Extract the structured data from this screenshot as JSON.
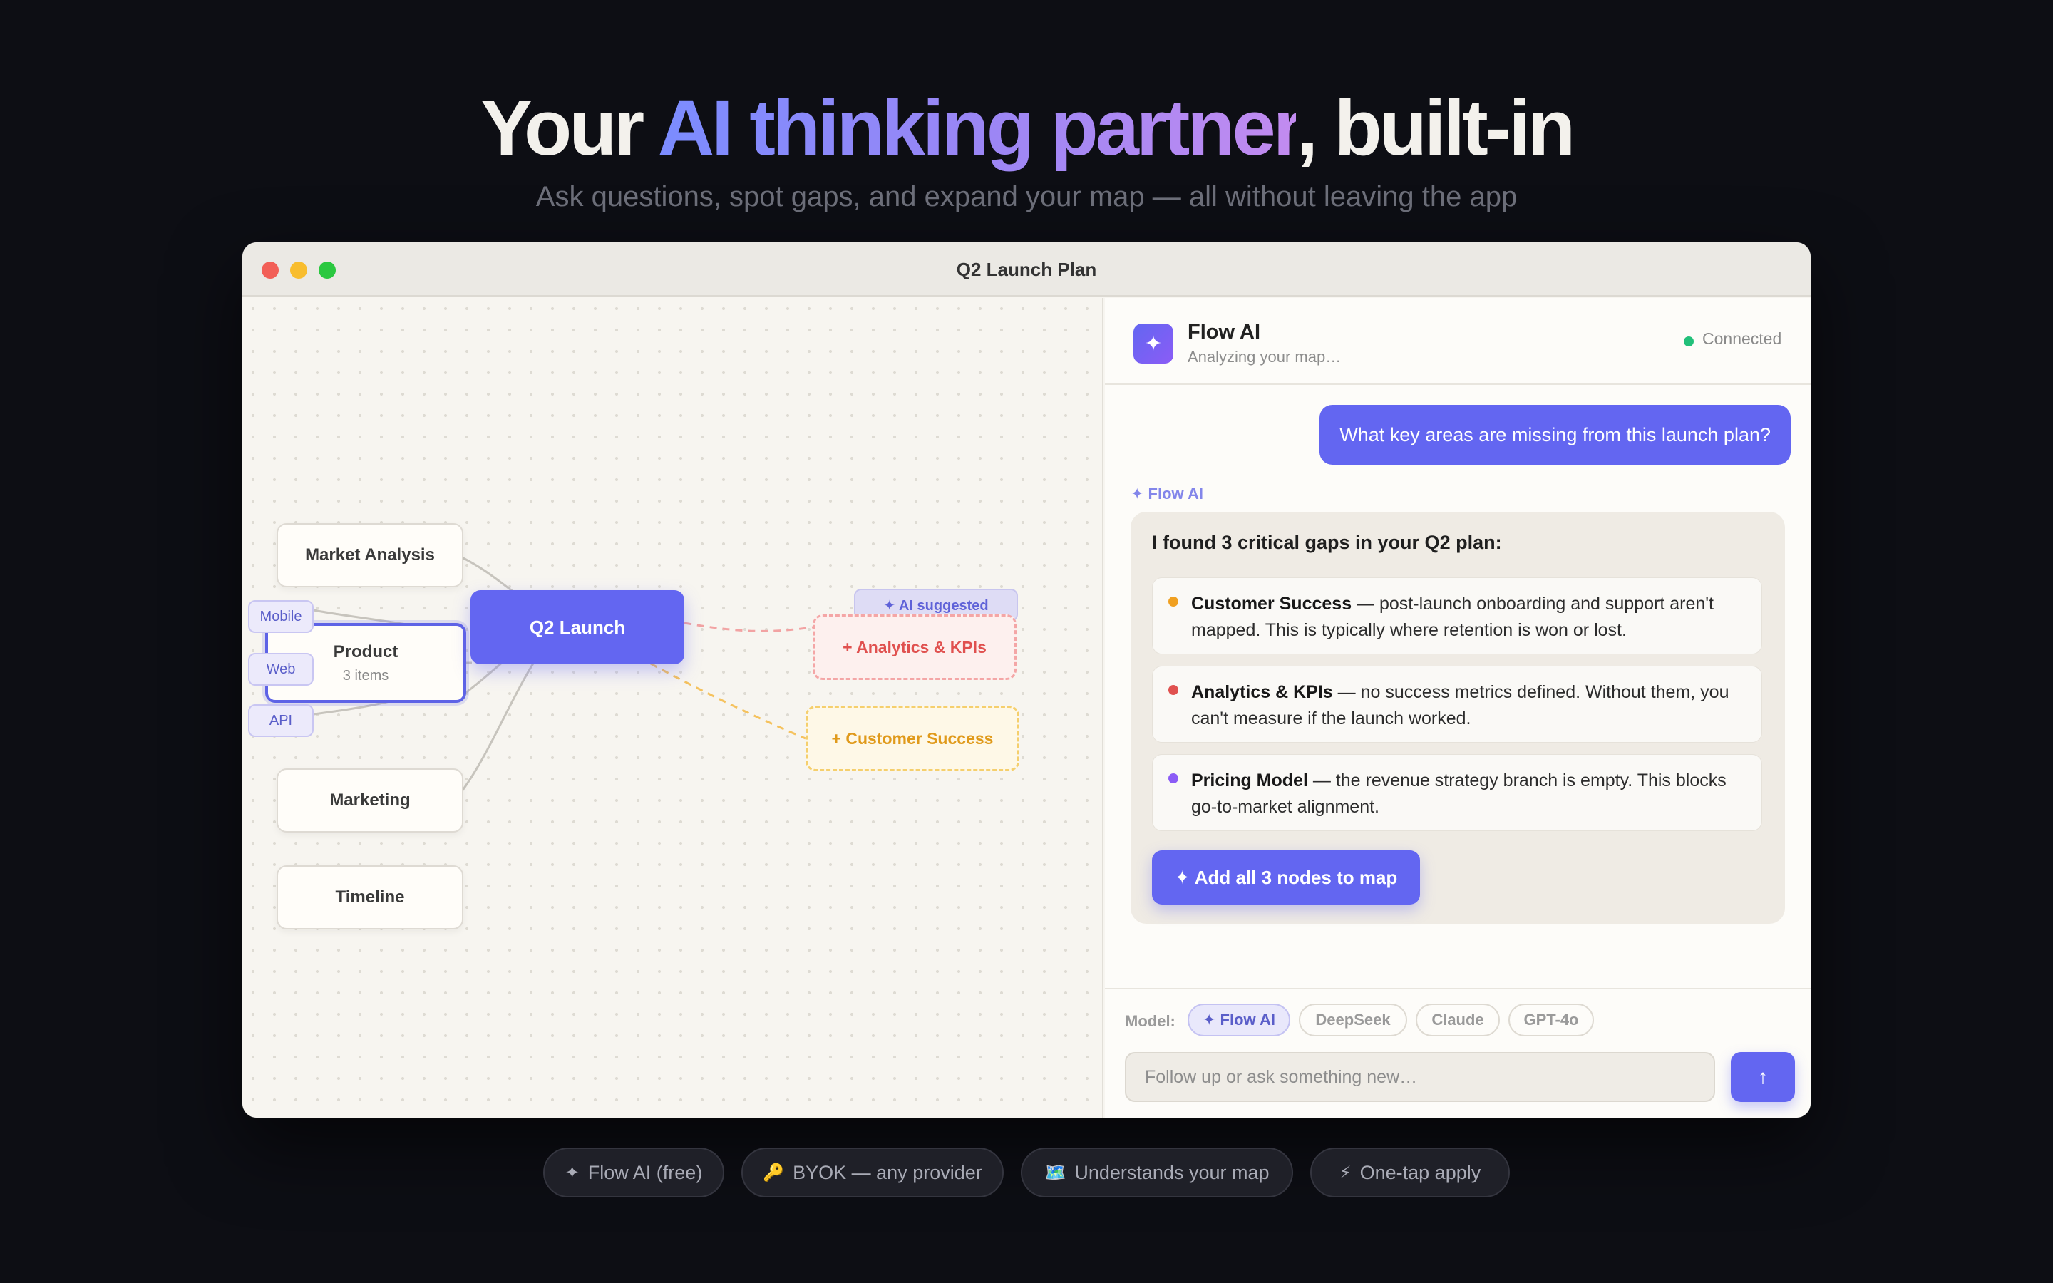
{
  "hero": {
    "title_pre": "Your ",
    "title_highlight": "AI thinking partner",
    "title_post": ", built-in",
    "subtitle": "Ask questions, spot gaps, and expand your map — all without leaving the app"
  },
  "window": {
    "title": "Q2 Launch Plan"
  },
  "canvas": {
    "center": "Q2 Launch",
    "nodes": {
      "market_analysis": "Market Analysis",
      "product": "Product",
      "product_sub": "3 items",
      "marketing": "Marketing",
      "timeline": "Timeline"
    },
    "chips": [
      "Mobile",
      "Web",
      "API"
    ],
    "ai_badge": "✦ AI suggested",
    "suggested": [
      "+ Analytics & KPIs",
      "+ Customer Success"
    ]
  },
  "chat": {
    "header": {
      "name": "Flow AI",
      "status": "Analyzing your map…",
      "connection": "Connected"
    },
    "user_message": "What key areas are missing from this launch plan?",
    "ai_label": "✦ Flow AI",
    "ai_heading": "I found 3 critical gaps in your Q2 plan:",
    "gaps": [
      {
        "title": "Customer Success",
        "text": " — post-launch onboarding and support aren't mapped. This is typically where retention is won or lost.",
        "color": "#f0a020"
      },
      {
        "title": "Analytics & KPIs",
        "text": " — no success metrics defined. Without them, you can't measure if the launch worked.",
        "color": "#e0514f"
      },
      {
        "title": "Pricing Model",
        "text": " — the revenue strategy branch is empty. This blocks go-to-market alignment.",
        "color": "#8b5cf6"
      }
    ],
    "add_button": "✦ Add all 3 nodes to map",
    "model_label": "Model:",
    "models": [
      "✦ Flow AI",
      "DeepSeek",
      "Claude",
      "GPT-4o"
    ],
    "input_placeholder": "Follow up or ask something new…",
    "send_icon": "↑"
  },
  "features": [
    {
      "icon": "✦",
      "label": "Flow AI (free)"
    },
    {
      "icon": "🔑",
      "label": "BYOK — any provider"
    },
    {
      "icon": "🗺️",
      "label": "Understands your map"
    },
    {
      "icon": "⚡",
      "label": "One-tap apply"
    }
  ]
}
